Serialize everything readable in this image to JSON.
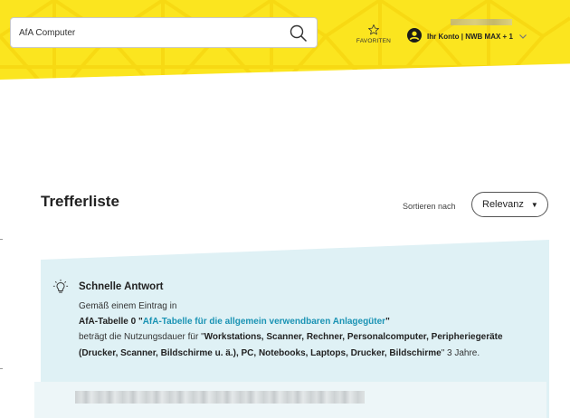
{
  "header": {
    "search": {
      "value": "AfA Computer",
      "placeholder": ""
    },
    "favorites_label": "FAVORITEN",
    "account_label": "Ihr Konto | NWB MAX + 1"
  },
  "results": {
    "title": "Trefferliste",
    "sort_label": "Sortieren nach",
    "sort_value": "Relevanz"
  },
  "quick_answer": {
    "title": "Schnelle Antwort",
    "line1": "Gemäß einem Eintrag in",
    "table_ref": "AfA-Tabelle 0 \"",
    "link_text": "AfA-Tabelle für die allgemein verwendbaren Anlagegüter",
    "table_ref_end": "\"",
    "line3_prefix": "beträgt die Nutzungsdauer für \"",
    "items": "Workstations, Scanner, Rechner, Personalcomputer, Peripheriegeräte (Drucker, Scanner, Bildschirme u. ä.), PC, Notebooks, Laptops, Drucker, Bildschirme",
    "line_end": "\" 3 Jahre."
  },
  "colors": {
    "header_yellow": "#fbe51f",
    "panel_blue": "#dff1f5",
    "link": "#1a93b4"
  },
  "icons": [
    "search-icon",
    "star-icon",
    "user-icon",
    "chevron-down-icon",
    "caret-down-icon",
    "bulb-icon"
  ]
}
